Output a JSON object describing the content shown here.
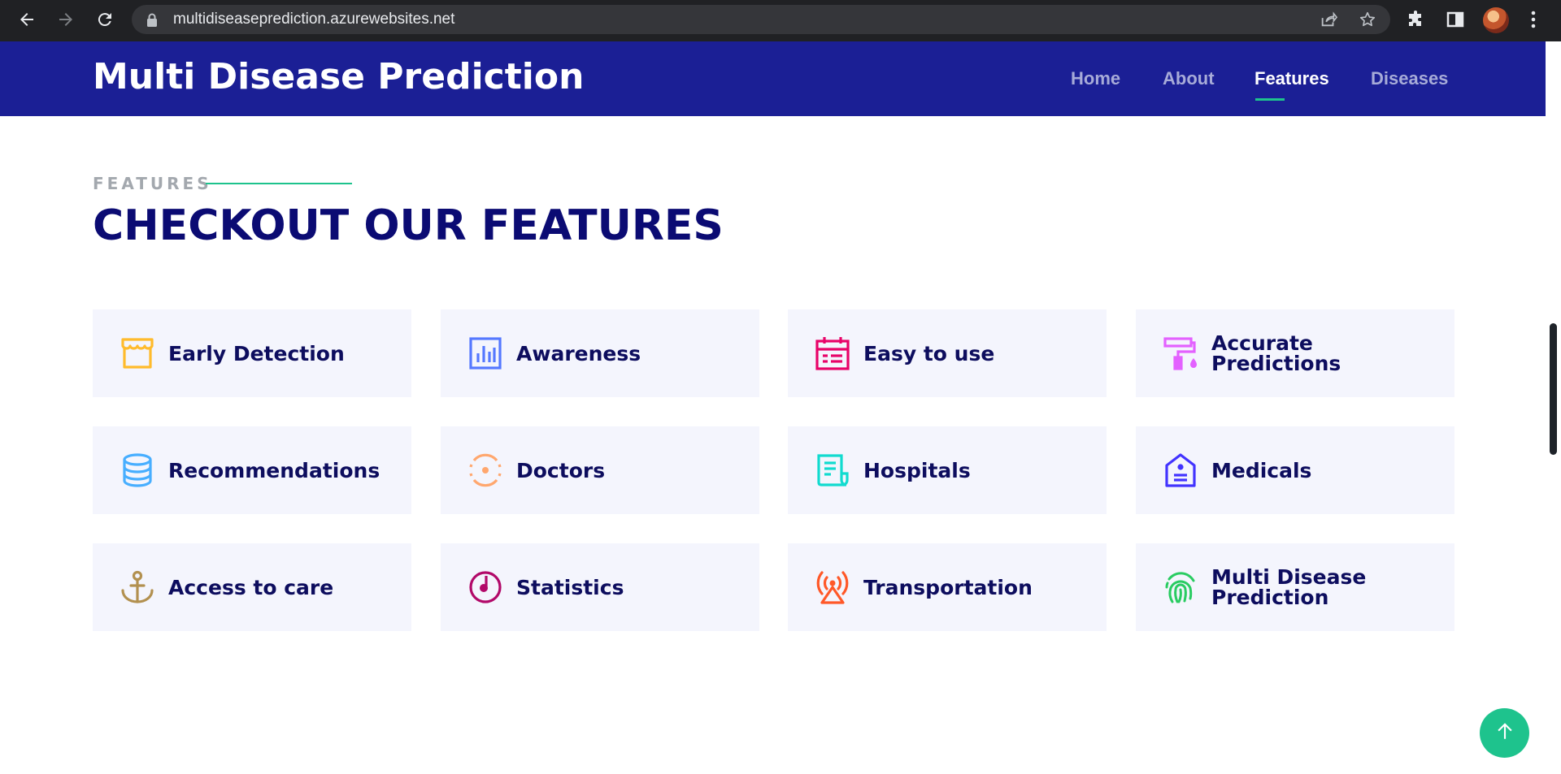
{
  "browser": {
    "url": "multidiseaseprediction.azurewebsites.net",
    "icons": [
      "back-arrow-icon",
      "forward-arrow-icon",
      "reload-icon",
      "lock-icon",
      "share-icon",
      "star-icon",
      "extensions-icon",
      "side-panel-icon",
      "profile-avatar",
      "more-menu-icon"
    ]
  },
  "header": {
    "logo": "Multi Disease Prediction",
    "nav": [
      {
        "label": "Home"
      },
      {
        "label": "About"
      },
      {
        "label": "Features",
        "active": true
      },
      {
        "label": "Diseases"
      }
    ]
  },
  "section": {
    "kicker": "FEATURES",
    "title": "CHECKOUT OUR FEATURES"
  },
  "features": [
    {
      "label": "Early Detection",
      "icon": "store-icon",
      "color": "#ffbb2c"
    },
    {
      "label": "Awareness",
      "icon": "bar-chart-icon",
      "color": "#5578ff"
    },
    {
      "label": "Easy to use",
      "icon": "calendar-icon",
      "color": "#e80368"
    },
    {
      "label": "Accurate Predictions",
      "icon": "paint-roller-icon",
      "color": "#e361ff"
    },
    {
      "label": "Recommendations",
      "icon": "database-icon",
      "color": "#47aeff"
    },
    {
      "label": "Doctors",
      "icon": "gradienter-icon",
      "color": "#ffa76e"
    },
    {
      "label": "Hospitals",
      "icon": "file-list-icon",
      "color": "#11dbcf"
    },
    {
      "label": "Medicals",
      "icon": "price-tag-icon",
      "color": "#4233ff"
    },
    {
      "label": "Access to care",
      "icon": "anchor-icon",
      "color": "#b2904f"
    },
    {
      "label": "Statistics",
      "icon": "disc-icon",
      "color": "#b20969"
    },
    {
      "label": "Transportation",
      "icon": "base-station-icon",
      "color": "#ff5828"
    },
    {
      "label": "Multi Disease Prediction",
      "icon": "fingerprint-icon",
      "color": "#29cc61"
    }
  ],
  "colors": {
    "header_bg": "#1b1f95",
    "accent": "#1ec38d",
    "title": "#0b0b73",
    "card_bg": "#f4f5fd"
  },
  "back_to_top": {
    "icon": "arrow-up-icon"
  }
}
